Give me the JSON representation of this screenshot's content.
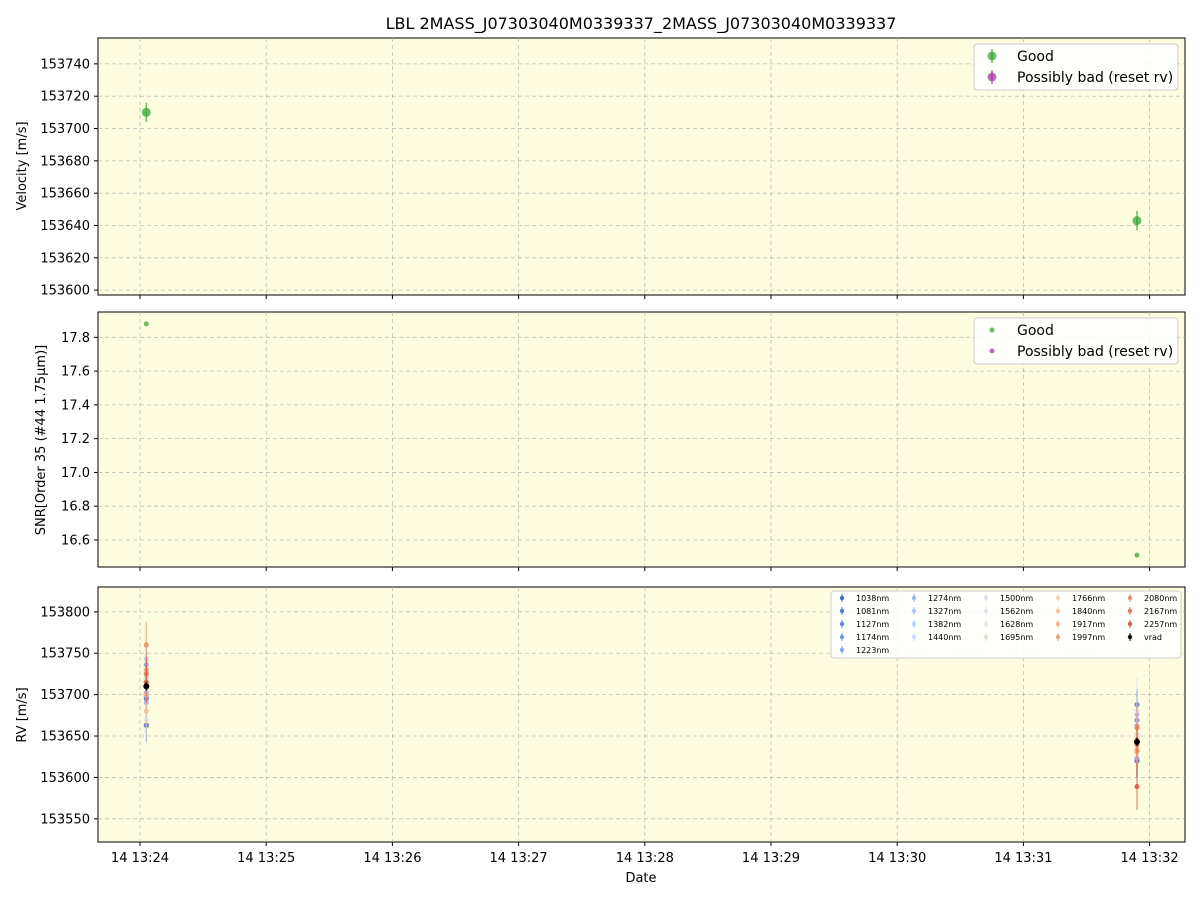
{
  "chart_data": {
    "title": "LBL 2MASS_J07303040M0339337_2MASS_J07303040M0339337",
    "type": "scatter",
    "xlabel": "Date",
    "x_ticks": [
      "14 13:24",
      "14 13:25",
      "14 13:26",
      "14 13:27",
      "14 13:28",
      "14 13:29",
      "14 13:30",
      "14 13:31",
      "14 13:32"
    ],
    "colors": {
      "background": "#fffde0",
      "good": "#2ca02c",
      "bad": "#9b30a0",
      "vrad": "#000000"
    },
    "panels": [
      {
        "ylabel": "Velocity [m/s]",
        "ylim": [
          153597,
          153756
        ],
        "y_ticks": [
          153600,
          153620,
          153640,
          153660,
          153680,
          153700,
          153720,
          153740
        ],
        "legend_position": "upper right",
        "legend": [
          "Good",
          "Possibly bad (reset rv)"
        ],
        "series": [
          {
            "name": "Good",
            "points": [
              {
                "t": "13:24:03",
                "y": 153710,
                "err": 6
              },
              {
                "t": "13:31:54",
                "y": 153643,
                "err": 6
              }
            ]
          },
          {
            "name": "Possibly bad (reset rv)",
            "points": []
          }
        ]
      },
      {
        "ylabel": "SNR[Order 35 (#44 1.75μm)]",
        "ylim": [
          16.44,
          17.95
        ],
        "y_ticks": [
          16.6,
          16.8,
          17.0,
          17.2,
          17.4,
          17.6,
          17.8
        ],
        "y_tick_labels": [
          "16.6",
          "16.8",
          "17.0",
          "17.2",
          "17.4",
          "17.6",
          "17.8"
        ],
        "legend_position": "upper right",
        "legend": [
          "Good",
          "Possibly bad (reset rv)"
        ],
        "series": [
          {
            "name": "Good",
            "points": [
              {
                "t": "13:24:03",
                "y": 17.88
              },
              {
                "t": "13:31:54",
                "y": 16.51
              }
            ]
          },
          {
            "name": "Possibly bad (reset rv)",
            "points": []
          }
        ]
      },
      {
        "ylabel": "RV [m/s]",
        "ylim": [
          153522,
          153830
        ],
        "y_ticks": [
          153550,
          153600,
          153650,
          153700,
          153750,
          153800
        ],
        "legend_position": "upper right",
        "legend": [
          "1038nm",
          "1081nm",
          "1127nm",
          "1174nm",
          "1223nm",
          "1274nm",
          "1327nm",
          "1382nm",
          "1440nm",
          "1500nm",
          "1562nm",
          "1628nm",
          "1695nm",
          "1766nm",
          "1840nm",
          "1917nm",
          "1997nm",
          "2080nm",
          "2167nm",
          "2257nm",
          "vrad"
        ],
        "band_colors": [
          "#3b5fd0",
          "#4a6fdc",
          "#5a80e6",
          "#6c90ee",
          "#7fa1f4",
          "#91b1f8",
          "#a3c0fb",
          "#b5cdfc",
          "#c6d9fc",
          "#d4e0f4",
          "#dde2ec",
          "#e3e2df",
          "#e8dccc",
          "#efcfb6",
          "#f3c0a0",
          "#f4ae8a",
          "#f29a76",
          "#ec8462",
          "#e26d51",
          "#d45241"
        ],
        "series_t": [
          "13:24:03",
          "13:31:54"
        ],
        "bands": [
          [
            153663,
            153620
          ],
          [
            153695,
            153688
          ],
          [
            153702,
            153669
          ],
          [
            153698,
            153662
          ],
          [
            153736,
            153623
          ],
          [
            153690,
            153676
          ],
          [
            153702,
            153631
          ],
          [
            153743,
            153652
          ],
          [
            153719,
            153640
          ],
          [
            153670,
            153680
          ],
          [
            153700,
            153640
          ],
          [
            153710,
            153650
          ],
          [
            153720,
            153660
          ],
          [
            153712,
            153636
          ],
          [
            153680,
            153630
          ],
          [
            153700,
            153646
          ],
          [
            153730,
            153633
          ],
          [
            153760,
            153660
          ],
          [
            153725,
            153640
          ],
          [
            153715,
            153589
          ]
        ],
        "band_err": [
          [
            20,
            20
          ],
          [
            15,
            18
          ],
          [
            15,
            15
          ],
          [
            15,
            18
          ],
          [
            15,
            20
          ],
          [
            18,
            18
          ],
          [
            20,
            20
          ],
          [
            15,
            20
          ],
          [
            18,
            20
          ],
          [
            30,
            40
          ],
          [
            22,
            25
          ],
          [
            20,
            22
          ],
          [
            18,
            22
          ],
          [
            20,
            25
          ],
          [
            22,
            26
          ],
          [
            22,
            26
          ],
          [
            22,
            26
          ],
          [
            28,
            30
          ],
          [
            20,
            25
          ],
          [
            25,
            28
          ]
        ],
        "vrad": [
          {
            "t": "13:24:03",
            "y": 153710,
            "err": 5
          },
          {
            "t": "13:31:54",
            "y": 153643,
            "err": 5
          }
        ]
      }
    ]
  }
}
